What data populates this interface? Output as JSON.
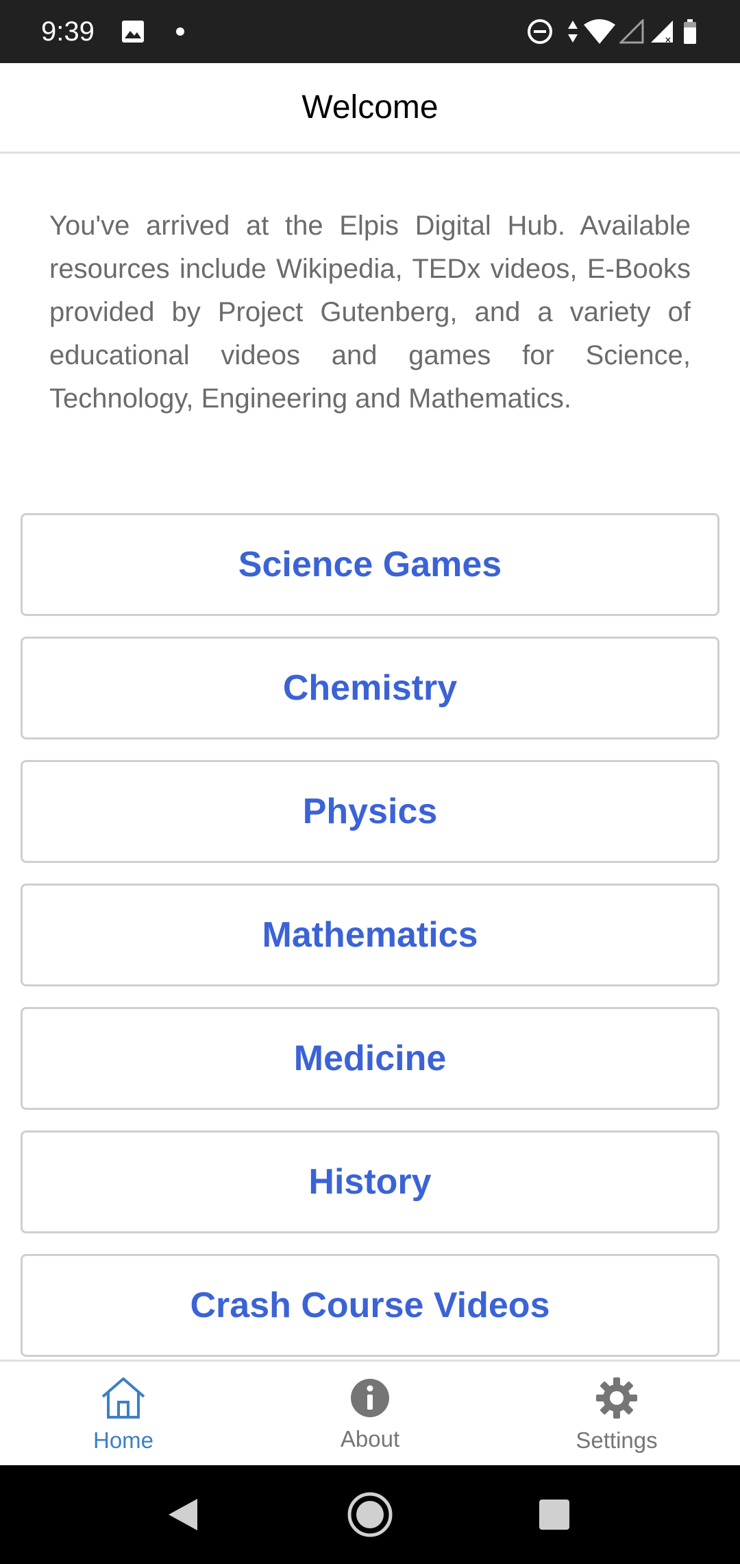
{
  "status_bar": {
    "time": "9:39",
    "icons": [
      "image-icon",
      "dot-icon",
      "do-not-disturb-icon",
      "data-arrows-icon",
      "wifi-icon",
      "signal-empty-icon",
      "signal-icon",
      "battery-icon"
    ]
  },
  "header": {
    "title": "Welcome"
  },
  "intro": {
    "text": "You've arrived at the Elpis Digital Hub. Available resources include Wikipedia, TEDx videos, E-Books provided by Project Gutenberg, and a variety of educational videos and games for Science, Technology, Engineering and Mathematics."
  },
  "buttons": [
    {
      "label": "Science Games"
    },
    {
      "label": "Chemistry"
    },
    {
      "label": "Physics"
    },
    {
      "label": "Mathematics"
    },
    {
      "label": "Medicine"
    },
    {
      "label": "History"
    },
    {
      "label": "Crash Course Videos"
    }
  ],
  "tabs": [
    {
      "label": "Home",
      "icon": "home-icon",
      "active": true
    },
    {
      "label": "About",
      "icon": "info-icon",
      "active": false
    },
    {
      "label": "Settings",
      "icon": "gear-icon",
      "active": false
    }
  ],
  "colors": {
    "accent": "#3b63d6",
    "tab_active": "#3d7fc6",
    "tab_inactive": "#757575",
    "status_bar": "#212121"
  }
}
